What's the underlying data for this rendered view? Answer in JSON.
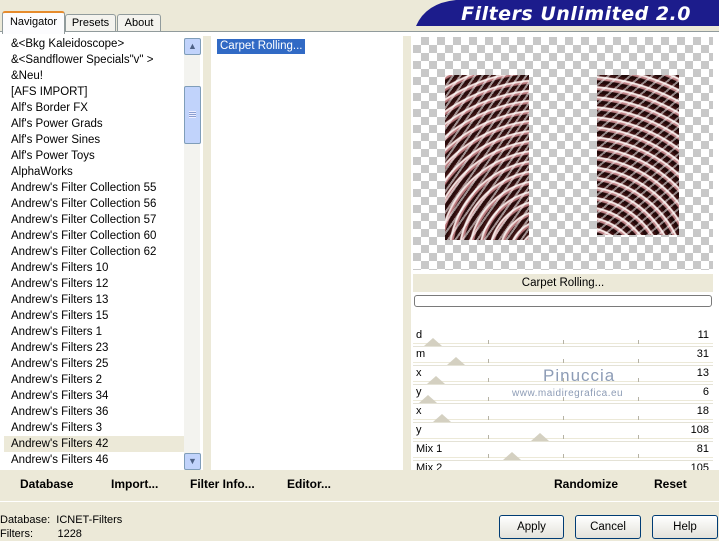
{
  "header": {
    "title": "Filters Unlimited 2.0"
  },
  "tabs": [
    {
      "label": "Navigator",
      "active": true
    },
    {
      "label": "Presets",
      "active": false
    },
    {
      "label": "About",
      "active": false
    }
  ],
  "categories": [
    "&<Bkg Kaleidoscope>",
    "&<Sandflower Specials\"v\" >",
    "&Neu!",
    "[AFS IMPORT]",
    "Alf's Border FX",
    "Alf's Power Grads",
    "Alf's Power Sines",
    "Alf's Power Toys",
    "AlphaWorks",
    "Andrew's Filter Collection 55",
    "Andrew's Filter Collection 56",
    "Andrew's Filter Collection 57",
    "Andrew's Filter Collection 60",
    "Andrew's Filter Collection 62",
    "Andrew's Filters 10",
    "Andrew's Filters 12",
    "Andrew's Filters 13",
    "Andrew's Filters 15",
    "Andrew's Filters 1",
    "Andrew's Filters 23",
    "Andrew's Filters 25",
    "Andrew's Filters 2",
    "Andrew's Filters 34",
    "Andrew's Filters 36",
    "Andrew's Filters 3",
    "Andrew's Filters 42",
    "Andrew's Filters 46"
  ],
  "selected_category": "Andrew's Filters 42",
  "filters": {
    "selected": "Carpet Rolling..."
  },
  "preview": {
    "caption": "Carpet Rolling...",
    "progress": 0
  },
  "sliders": [
    {
      "label": "d",
      "value": "11",
      "level": 0.04
    },
    {
      "label": "m",
      "value": "31",
      "level": 0.12
    },
    {
      "label": "x",
      "value": "13",
      "level": 0.05
    },
    {
      "label": "y",
      "value": "6",
      "level": 0.02
    },
    {
      "label": "x",
      "value": "18",
      "level": 0.07
    },
    {
      "label": "y",
      "value": "108",
      "level": 0.42
    },
    {
      "label": "Mix 1",
      "value": "81",
      "level": 0.32
    },
    {
      "label": "Mix 2",
      "value": "105",
      "level": 0.41
    }
  ],
  "watermark": {
    "name": "Pinuccia",
    "url": "www.maidiregrafica.eu"
  },
  "commands": {
    "database": "Database",
    "import": "Import...",
    "filter_info": "Filter Info...",
    "editor": "Editor...",
    "randomize": "Randomize",
    "reset": "Reset"
  },
  "status": {
    "database_label": "Database:",
    "database_value": "ICNET-Filters",
    "filters_label": "Filters:",
    "filters_value": "1228"
  },
  "buttons": {
    "apply": "Apply",
    "cancel": "Cancel",
    "help": "Help"
  },
  "colors": {
    "banner": "#1c1c8c",
    "selection": "#316ac5",
    "tab_accent": "#e68b2c"
  }
}
